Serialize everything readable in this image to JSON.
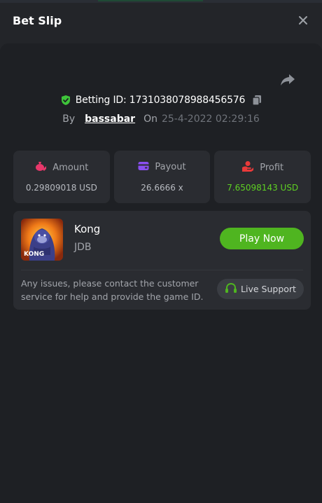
{
  "header": {
    "title": "Bet Slip"
  },
  "bet": {
    "betting_id_label": "Betting ID: 1731038078988456576",
    "by_label": "By",
    "username": "bassabar",
    "on_label": "On",
    "datetime": "25-4-2022 02:29:16"
  },
  "stats": {
    "amount": {
      "label": "Amount",
      "value": "0.29809018 USD",
      "icon": "money-bag-icon"
    },
    "payout": {
      "label": "Payout",
      "value": "26.6666 x",
      "icon": "wallet-card-icon"
    },
    "profit": {
      "label": "Profit",
      "value": "7.65098143 USD",
      "icon": "hand-coin-icon"
    }
  },
  "game": {
    "name": "Kong",
    "provider": "JDB",
    "thumb_text": "KONG",
    "play_label": "Play Now",
    "note": "Any issues, please contact the customer service for help and provide the game ID.",
    "support_label": "Live Support"
  },
  "colors": {
    "accent_green": "#4fb520",
    "profit_green": "#5ed023",
    "amount_pink": "#e8386b",
    "payout_purple": "#8a4ff0",
    "profit_red": "#e83a3a"
  }
}
